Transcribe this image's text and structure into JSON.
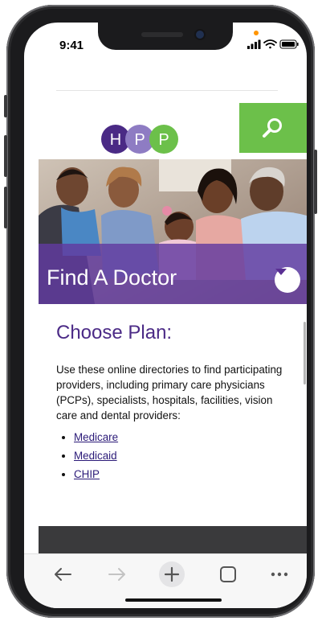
{
  "status_bar": {
    "time": "9:41"
  },
  "header": {
    "logo_letters": [
      "H",
      "P",
      "P"
    ],
    "logo_colors": [
      "#4a2a85",
      "#8e7cc3",
      "#6cc04a"
    ],
    "search_icon": "search-icon"
  },
  "hero": {
    "title": "Find A Doctor",
    "toggle_icon": "chevron-down-icon"
  },
  "main": {
    "section_title": "Choose Plan:",
    "description": "Use these online directories to find participating providers, including primary care physicians (PCPs), specialists, hospitals, facilities, vision care and dental providers:",
    "plans": [
      "Medicare",
      "Medicaid",
      "CHIP"
    ]
  },
  "browser_toolbar": {
    "icons": [
      "back-arrow-icon",
      "forward-arrow-icon",
      "new-tab-plus-icon",
      "tabs-square-icon",
      "more-dots-icon"
    ]
  },
  "colors": {
    "brand_purple": "#4b2a86",
    "brand_green": "#6cc04a",
    "overlay_purple": "#623aa0"
  }
}
